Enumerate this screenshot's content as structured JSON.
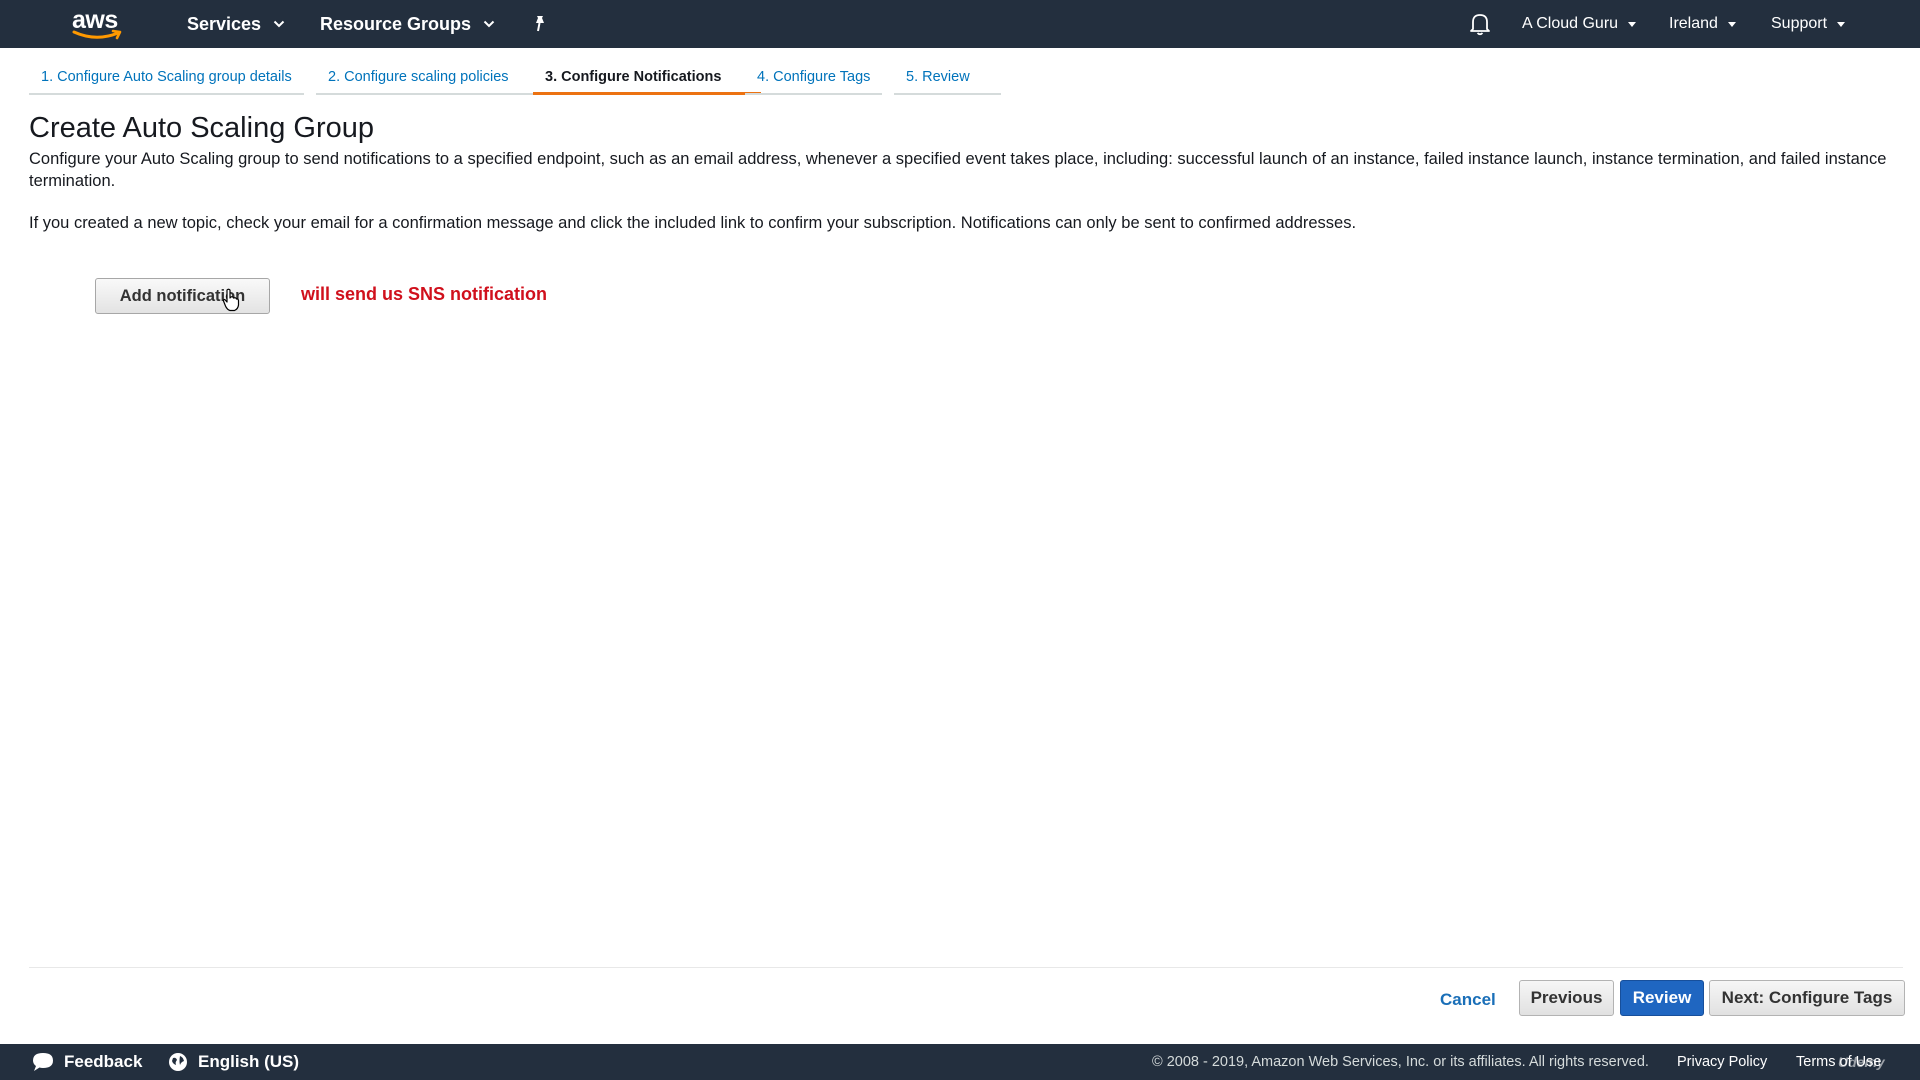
{
  "topnav": {
    "logo_text": "aws",
    "services": "Services",
    "resource_groups": "Resource Groups",
    "account": "A Cloud Guru",
    "region": "Ireland",
    "support": "Support"
  },
  "steps": [
    {
      "label": "1. Configure Auto Scaling group details",
      "active": false
    },
    {
      "label": "2. Configure scaling policies",
      "active": false
    },
    {
      "label": "3. Configure Notifications",
      "active": true
    },
    {
      "label": "4. Configure Tags",
      "active": false
    },
    {
      "label": "5. Review",
      "active": false
    }
  ],
  "main": {
    "title": "Create Auto Scaling Group",
    "description": "Configure your Auto Scaling group to send notifications to a specified endpoint, such as an email address, whenever a specified event takes place, including: successful launch of an instance, failed instance launch, instance termination, and failed instance termination.",
    "description2": "If you created a new topic, check your email for a confirmation message and click the included link to confirm your subscription. Notifications can only be sent to confirmed addresses.",
    "add_notification": "Add notification",
    "annotation": "will send us SNS notification"
  },
  "actions": {
    "cancel": "Cancel",
    "previous": "Previous",
    "review": "Review",
    "next": "Next: Configure Tags"
  },
  "bottombar": {
    "feedback": "Feedback",
    "language": "English (US)",
    "copyright": "© 2008 - 2019, Amazon Web Services, Inc. or its affiliates. All rights reserved.",
    "privacy": "Privacy Policy",
    "terms": "Terms of Use",
    "watermark": "Udemy"
  },
  "colors": {
    "nav_bg": "#232f3e",
    "link": "#0073bb",
    "active_tab_underline": "#ec7211",
    "primary_button": "#1f66c1",
    "annotation": "#d0101c"
  },
  "icons": [
    "aws-smile-icon",
    "chevron-down-icon",
    "pin-icon",
    "bell-icon",
    "caret-down-icon",
    "hand-cursor-icon",
    "chat-bubble-icon",
    "globe-icon"
  ]
}
